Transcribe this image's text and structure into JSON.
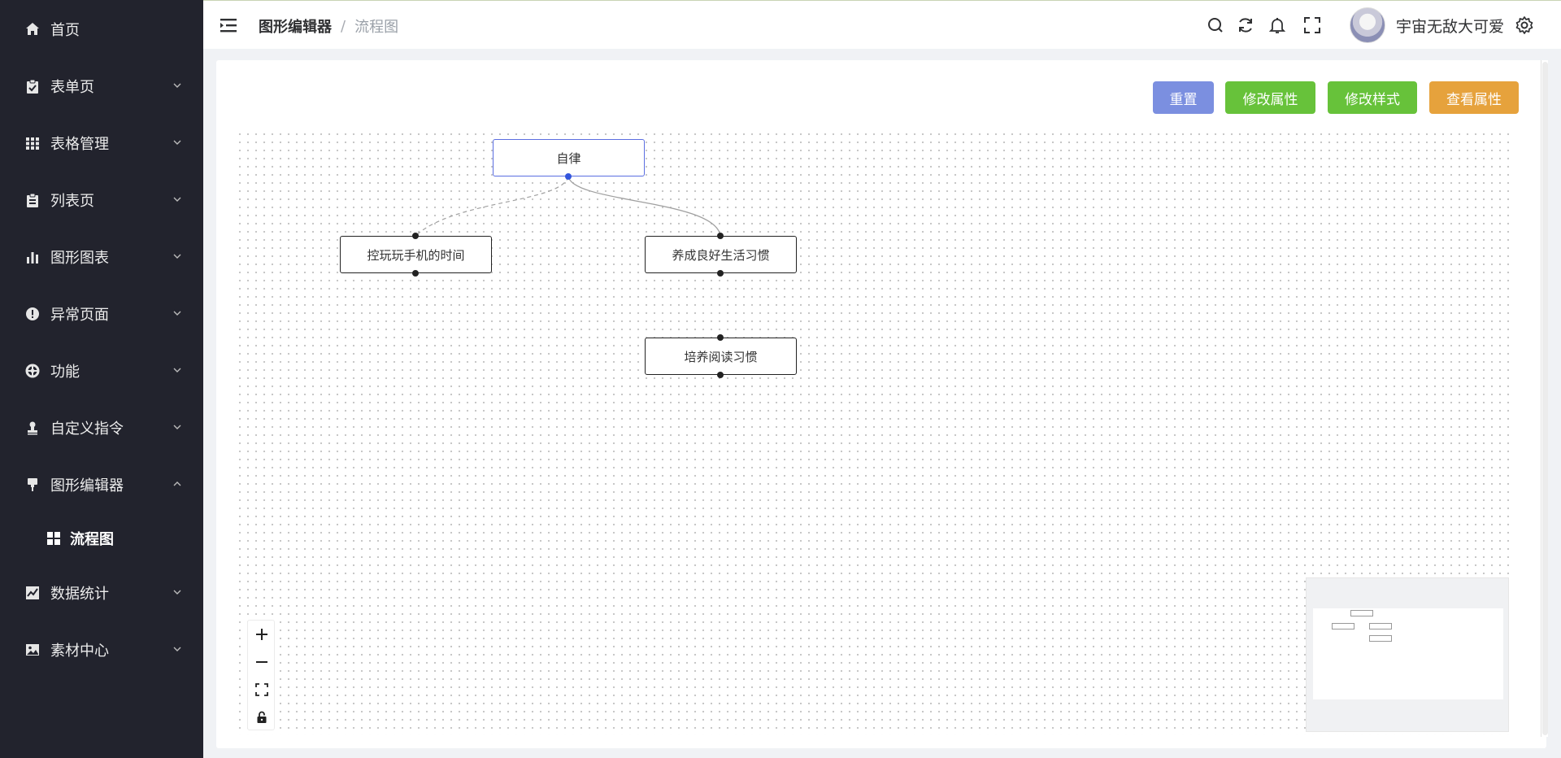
{
  "sidebar": {
    "items": [
      {
        "label": "首页",
        "icon": "home-icon"
      },
      {
        "label": "表单页",
        "icon": "clipboard-check-icon"
      },
      {
        "label": "表格管理",
        "icon": "grid-icon"
      },
      {
        "label": "列表页",
        "icon": "clipboard-list-icon"
      },
      {
        "label": "图形图表",
        "icon": "bar-chart-icon"
      },
      {
        "label": "异常页面",
        "icon": "exclamation-circle-icon"
      },
      {
        "label": "功能",
        "icon": "lifebuoy-icon"
      },
      {
        "label": "自定义指令",
        "icon": "user-stamp-icon"
      },
      {
        "label": "图形编辑器",
        "icon": "brush-icon",
        "expanded": true
      },
      {
        "label": "数据统计",
        "icon": "line-chart-icon"
      },
      {
        "label": "素材中心",
        "icon": "image-icon"
      }
    ],
    "sub_item": {
      "label": "流程图",
      "icon": "dashboard-grid-icon"
    }
  },
  "header": {
    "breadcrumb": [
      "图形编辑器",
      "流程图"
    ],
    "separator": "/",
    "username": "宇宙无敌大可爱",
    "icons": [
      "search-icon",
      "refresh-icon",
      "bell-icon",
      "fullscreen-icon",
      "avatar",
      "gear-icon"
    ]
  },
  "toolbar": {
    "reset_label": "重置",
    "edit_props_label": "修改属性",
    "edit_style_label": "修改样式",
    "view_props_label": "查看属性",
    "colors": {
      "reset": "#7b8fe0",
      "edit_props": "#67c23a",
      "edit_style": "#67c23a",
      "view_props": "#e6a23c"
    }
  },
  "flow": {
    "nodes": [
      {
        "id": "n1",
        "label": "自律",
        "selected": true
      },
      {
        "id": "n2",
        "label": "控玩玩手机的时间"
      },
      {
        "id": "n3",
        "label": "养成良好生活习惯"
      },
      {
        "id": "n4",
        "label": "培养阅读习惯"
      }
    ],
    "edges": [
      {
        "from": "n1",
        "to": "n2",
        "style": "dashed"
      },
      {
        "from": "n1",
        "to": "n3",
        "style": "solid"
      }
    ]
  },
  "zoom_controls": [
    "zoom-in-icon",
    "zoom-out-icon",
    "fit-view-icon",
    "lock-icon"
  ],
  "colors": {
    "sidebar_bg": "#22232d",
    "selected_node_border": "#5b6ee1",
    "selected_anchor": "#3355dd"
  }
}
